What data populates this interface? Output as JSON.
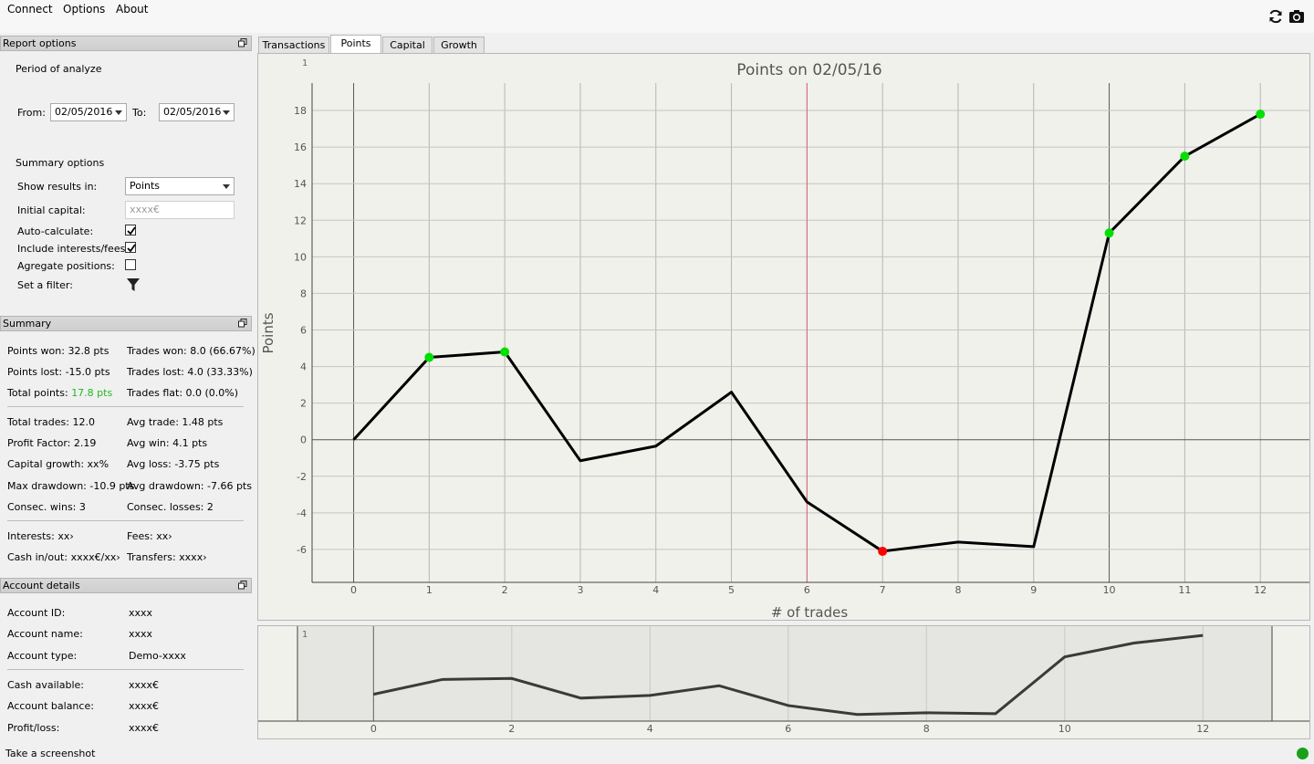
{
  "menu": {
    "connect": "Connect",
    "options": "Options",
    "about": "About"
  },
  "toolbar": {
    "refresh_icon": "refresh-icon",
    "screenshot_icon": "camera-icon"
  },
  "report_options": {
    "title": "Report options",
    "period_label": "Period of analyze",
    "from_label": "From:",
    "from_value": "02/05/2016",
    "to_label": "To:",
    "to_value": "02/05/2016",
    "summary_options_label": "Summary options",
    "show_results_label": "Show results in:",
    "show_results_value": "Points",
    "initial_capital_label": "Initial capital:",
    "initial_capital_placeholder": "xxxx€",
    "auto_calculate_label": "Auto-calculate:",
    "auto_calculate_checked": true,
    "include_interests_label": "Include interests/fees:",
    "include_interests_checked": true,
    "aggregate_label": "Agregate positions:",
    "aggregate_checked": false,
    "filter_label": "Set a filter:"
  },
  "summary": {
    "title": "Summary",
    "points_won": "Points won: 32.8 pts",
    "trades_won": "Trades won: 8.0 (66.67%)",
    "points_lost": "Points lost: -15.0 pts",
    "trades_lost": "Trades lost: 4.0 (33.33%)",
    "total_points_label": "Total points:",
    "total_points_value": "17.8 pts",
    "trades_flat": "Trades flat: 0.0 (0.0%)",
    "total_trades": "Total trades: 12.0",
    "avg_trade": "Avg trade: 1.48 pts",
    "profit_factor": "Profit Factor: 2.19",
    "avg_win": "Avg win: 4.1 pts",
    "capital_growth": "Capital growth: xx%",
    "avg_loss": "Avg loss: -3.75 pts",
    "max_drawdown": "Max drawdown: -10.9 pts",
    "avg_drawdown": "Avg drawdown: -7.66 pts",
    "consec_wins": "Consec. wins: 3",
    "consec_losses": "Consec. losses: 2",
    "interests": "Interests: xx›",
    "fees": "Fees: xx›",
    "cash_in_out": "Cash in/out: xxxx€/xx›",
    "transfers": "Transfers: xxxx›",
    "positive_color": "#22b822"
  },
  "account": {
    "title": "Account details",
    "id_label": "Account ID:",
    "id_value": "xxxx",
    "name_label": "Account name:",
    "name_value": "xxxx",
    "type_label": "Account type:",
    "type_value": "Demo-xxxx",
    "cash_label": "Cash available:",
    "cash_value": "xxxx€",
    "balance_label": "Account balance:",
    "balance_value": "xxxx€",
    "pl_label": "Profit/loss:",
    "pl_value": "xxxx€"
  },
  "tabs": [
    {
      "label": "Transactions",
      "active": false
    },
    {
      "label": "Points",
      "active": true
    },
    {
      "label": "Capital",
      "active": false
    },
    {
      "label": "Growth",
      "active": false
    }
  ],
  "status": {
    "text": "Take a screenshot",
    "indicator_color": "#1aa01a"
  },
  "chart_data": [
    {
      "type": "line",
      "title": "Points on 02/05/16",
      "xlabel": "# of trades",
      "ylabel": "Points",
      "corner_label": "1",
      "x": [
        0,
        1,
        2,
        3,
        4,
        5,
        6,
        7,
        8,
        9,
        10,
        11,
        12
      ],
      "y": [
        0,
        4.5,
        4.8,
        -1.15,
        -0.35,
        2.6,
        -3.4,
        -6.1,
        -5.6,
        -5.85,
        11.3,
        15.5,
        17.8
      ],
      "markers": [
        {
          "x": 1,
          "color": "#00e000"
        },
        {
          "x": 2,
          "color": "#00e000"
        },
        {
          "x": 7,
          "color": "#ff0000"
        },
        {
          "x": 10,
          "color": "#00e000"
        },
        {
          "x": 11,
          "color": "#00e000"
        },
        {
          "x": 12,
          "color": "#00e000"
        }
      ],
      "xlim": [
        -0.55,
        12.65
      ],
      "ylim": [
        -7.8,
        19.5
      ],
      "yticks": [
        18,
        16,
        14,
        12,
        10,
        8,
        6,
        4,
        2,
        0,
        -2,
        -4,
        -6
      ],
      "xticks": [
        0,
        1,
        2,
        3,
        4,
        5,
        6,
        7,
        8,
        9,
        10,
        11,
        12
      ],
      "vertical_marker_x": 6,
      "vertical_marker_color": "#e06070",
      "grid": true
    },
    {
      "type": "line",
      "title": "",
      "corner_label": "1",
      "x": [
        0,
        1,
        2,
        3,
        4,
        5,
        6,
        7,
        8,
        9,
        10,
        11,
        12
      ],
      "y": [
        0,
        4.5,
        4.8,
        -1.15,
        -0.35,
        2.6,
        -3.4,
        -6.1,
        -5.6,
        -5.85,
        11.3,
        15.5,
        17.8
      ],
      "xticks": [
        0,
        2,
        4,
        6,
        8,
        10,
        12
      ],
      "xlim": [
        -1.1,
        13.0
      ],
      "ylim": [
        -7.0,
        19.5
      ],
      "grid": true
    }
  ]
}
